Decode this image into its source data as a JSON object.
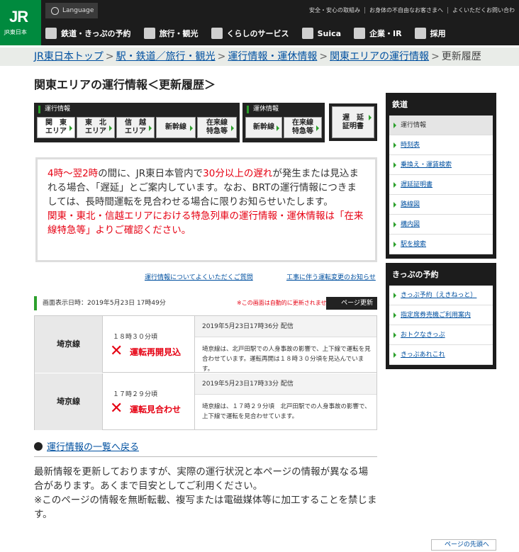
{
  "header": {
    "logo_main": "JR",
    "logo_sub": "JR東日本",
    "language": "Language",
    "util": [
      "安全・安心の取組み",
      "お身体の不自由なお客さまへ",
      "よくいただくお問い合わ"
    ],
    "gnav": [
      "鉄道・きっぷの予約",
      "旅行・観光",
      "くらしのサービス",
      "Suica",
      "企業・IR",
      "採用"
    ]
  },
  "breadcrumb": {
    "items": [
      "JR東日本トップ",
      "駅・鉄道／旅行・観光",
      "運行情報・運休情報",
      "関東エリアの運行情報"
    ],
    "sep": ">",
    "current": "更新履歴"
  },
  "page_title": "関東エリアの運行情報＜更新履歴＞",
  "tabs": {
    "group1_label": "運行情報",
    "group1": [
      "関　東\nエリア",
      "東　北\nエリア",
      "信　越\nエリア",
      "新幹線",
      "在来線\n特急等"
    ],
    "group2_label": "運休情報",
    "group2": [
      "新幹線",
      "在来線\n特急等"
    ],
    "delay": "遅　延\n証明書"
  },
  "notice": {
    "p1_red1": "4時〜翌2時",
    "p1_a": "の間に、JR東日本管内で",
    "p1_red2": "30分以上の遅れ",
    "p1_b": "が発生または見込まれる場合、「遅延」とご案内しています。なお、BRTの運行情報につきましては、長時間運転を見合わせる場合に限りお知らせいたします。",
    "p2": "関東・東北・信越エリアにおける特急列車の運行情報・運休情報は「在来線特急等」よりご確認ください。"
  },
  "links": {
    "faq": "運行情報についてよくいただくご質問",
    "construction": "工事に伴う運転変更のお知らせ"
  },
  "update": {
    "time": "画面表示日時：2019年5月23日 17時49分",
    "note": "※この画面は自動的に更新されません",
    "button": "ページ更新"
  },
  "rows": [
    {
      "line": "埼京線",
      "time": "１８時３０分頃",
      "status": "運転再開見込",
      "date": "2019年5月23日17時36分 配信",
      "text": "埼京線は、北戸田駅での人身事故の影響で、上下線で運転を見合わせています。運転再開は１８時３０分頃を見込んでいます。"
    },
    {
      "line": "埼京線",
      "time": "１７時２９分頃",
      "status": "運転見合わせ",
      "date": "2019年5月23日17時33分 配信",
      "text": "埼京線は、１７時２９分頃　北戸田駅での人身事故の影響で、上下線で運転を見合わせています。"
    }
  ],
  "back": "運行情報の一覧へ戻る",
  "footer": {
    "p1": "最新情報を更新しておりますが、実際の運行状況と本ページの情報が異なる場合があります。あくまで目安としてご利用ください。",
    "p2": "※このページの情報を無断転載、複写または電磁媒体等に加工することを禁じます。"
  },
  "pagetop": "ページの先頭へ",
  "sidebar": {
    "rail_title": "鉄道",
    "rail": [
      "運行情報",
      "時刻表",
      "乗換え・運賃検索",
      "遅延証明書",
      "路線図",
      "構内図",
      "駅を検索"
    ],
    "ticket_title": "きっぷの予約",
    "ticket": [
      "きっぷ予約（えきねっと）",
      "指定席券売機ご利用案内",
      "おトクなきっぷ",
      "きっぷあれこれ"
    ]
  }
}
